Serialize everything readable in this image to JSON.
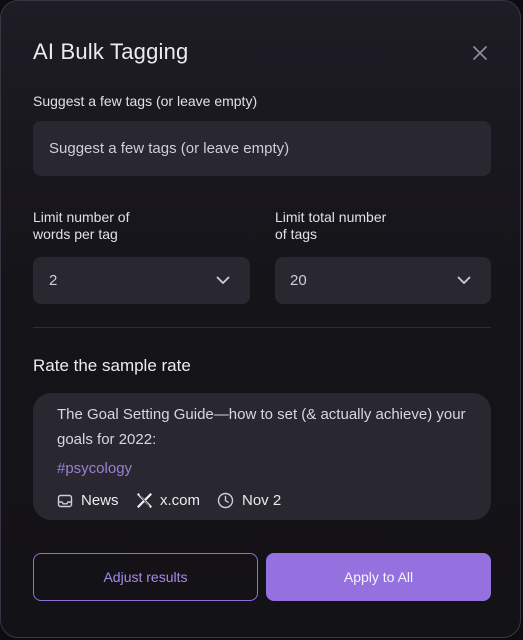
{
  "dialog": {
    "title": "AI Bulk Tagging",
    "close_icon": "close-icon"
  },
  "suggest": {
    "label": "Suggest a few tags (or leave empty)",
    "placeholder": "Suggest a few tags (or leave empty)",
    "value": ""
  },
  "words_limit": {
    "label_line1": "Limit number of",
    "label_line2": "words per tag",
    "selected": "2"
  },
  "tags_limit": {
    "label_line1": "Limit total number",
    "label_line2": "of tags",
    "selected": "20"
  },
  "sample": {
    "section_title": "Rate the sample rate",
    "text": "The Goal Setting Guide—how to set (& actually achieve) your goals for 2022:",
    "tag": "#psycology",
    "source": "News",
    "source_icon": "inbox-icon",
    "site": "x.com",
    "site_icon": "x-logo-icon",
    "date": "Nov 2",
    "date_icon": "clock-icon"
  },
  "actions": {
    "adjust_label": "Adjust results",
    "apply_label": "Apply to All"
  },
  "colors": {
    "accent": "#9571e0",
    "accent_text": "#a58ce6",
    "tag": "#9a7fd8",
    "surface": "#29272f"
  }
}
